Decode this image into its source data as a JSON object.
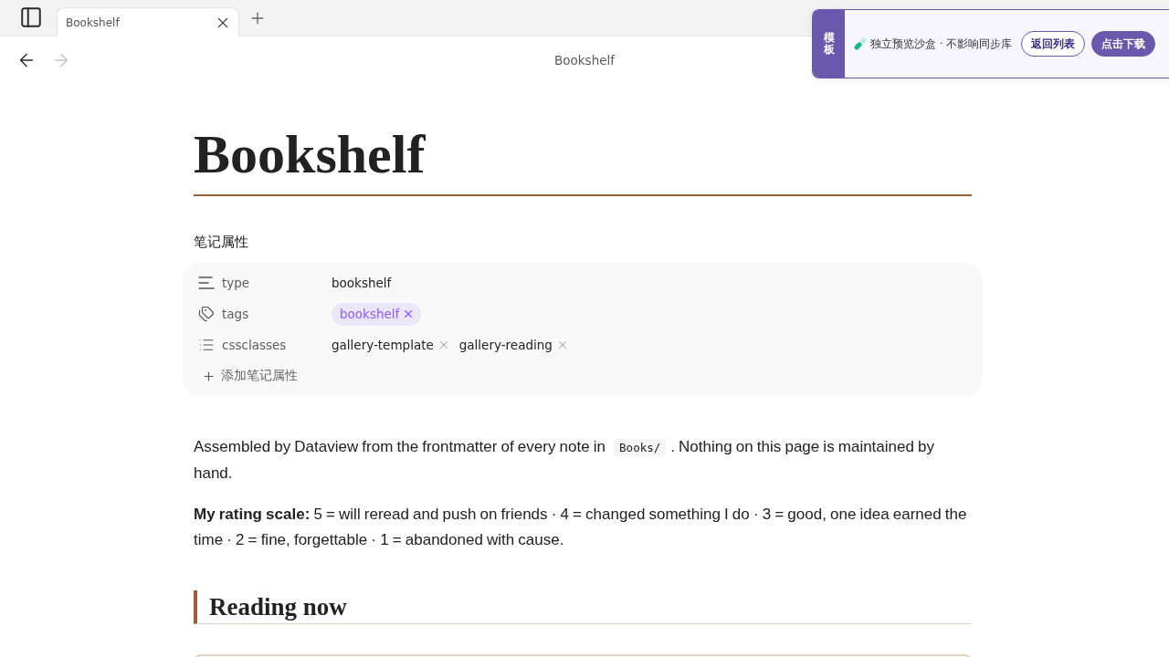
{
  "tab_bar": {
    "tabs": [
      {
        "title": "Bookshelf",
        "selected": true
      }
    ]
  },
  "navigation": {
    "back": {
      "disabled": false
    },
    "forward": {
      "disabled": true
    },
    "title": "Bookshelf"
  },
  "template_banner": {
    "label": "模板",
    "message": "独立预览沙盒 · 不影响同步库",
    "buttons": [
      {
        "label": "返回列表",
        "kind": "outline"
      },
      {
        "label": "点击下载",
        "kind": "filled"
      }
    ]
  },
  "note": {
    "title": "Bookshelf",
    "properties_heading": "笔记属性",
    "properties": [
      {
        "kind": "text",
        "key": "type",
        "value": "bookshelf"
      },
      {
        "kind": "tags",
        "key": "tags",
        "values": [
          "bookshelf"
        ]
      },
      {
        "kind": "list",
        "key": "cssclasses",
        "values": [
          "gallery-template",
          "gallery-reading"
        ]
      }
    ],
    "add_property": "添加笔记属性",
    "paragraphs": [
      {
        "parts": [
          {
            "kind": "text",
            "text": "Assembled by Dataview from the frontmatter of every note in "
          },
          {
            "kind": "code",
            "text": "Books/"
          },
          {
            "kind": "text",
            "text": ". Nothing on this page is maintained by hand."
          }
        ]
      },
      {
        "parts": [
          {
            "kind": "text",
            "text": "**My rating scale:** 5 = will reread and push on friends · 4 = changed something I do · 3 = good, one idea earned the time · 2 = fine, forgettable · 1 = abandoned with cause."
          }
        ]
      }
    ],
    "sections": [
      {
        "heading": "Reading now"
      }
    ]
  }
}
